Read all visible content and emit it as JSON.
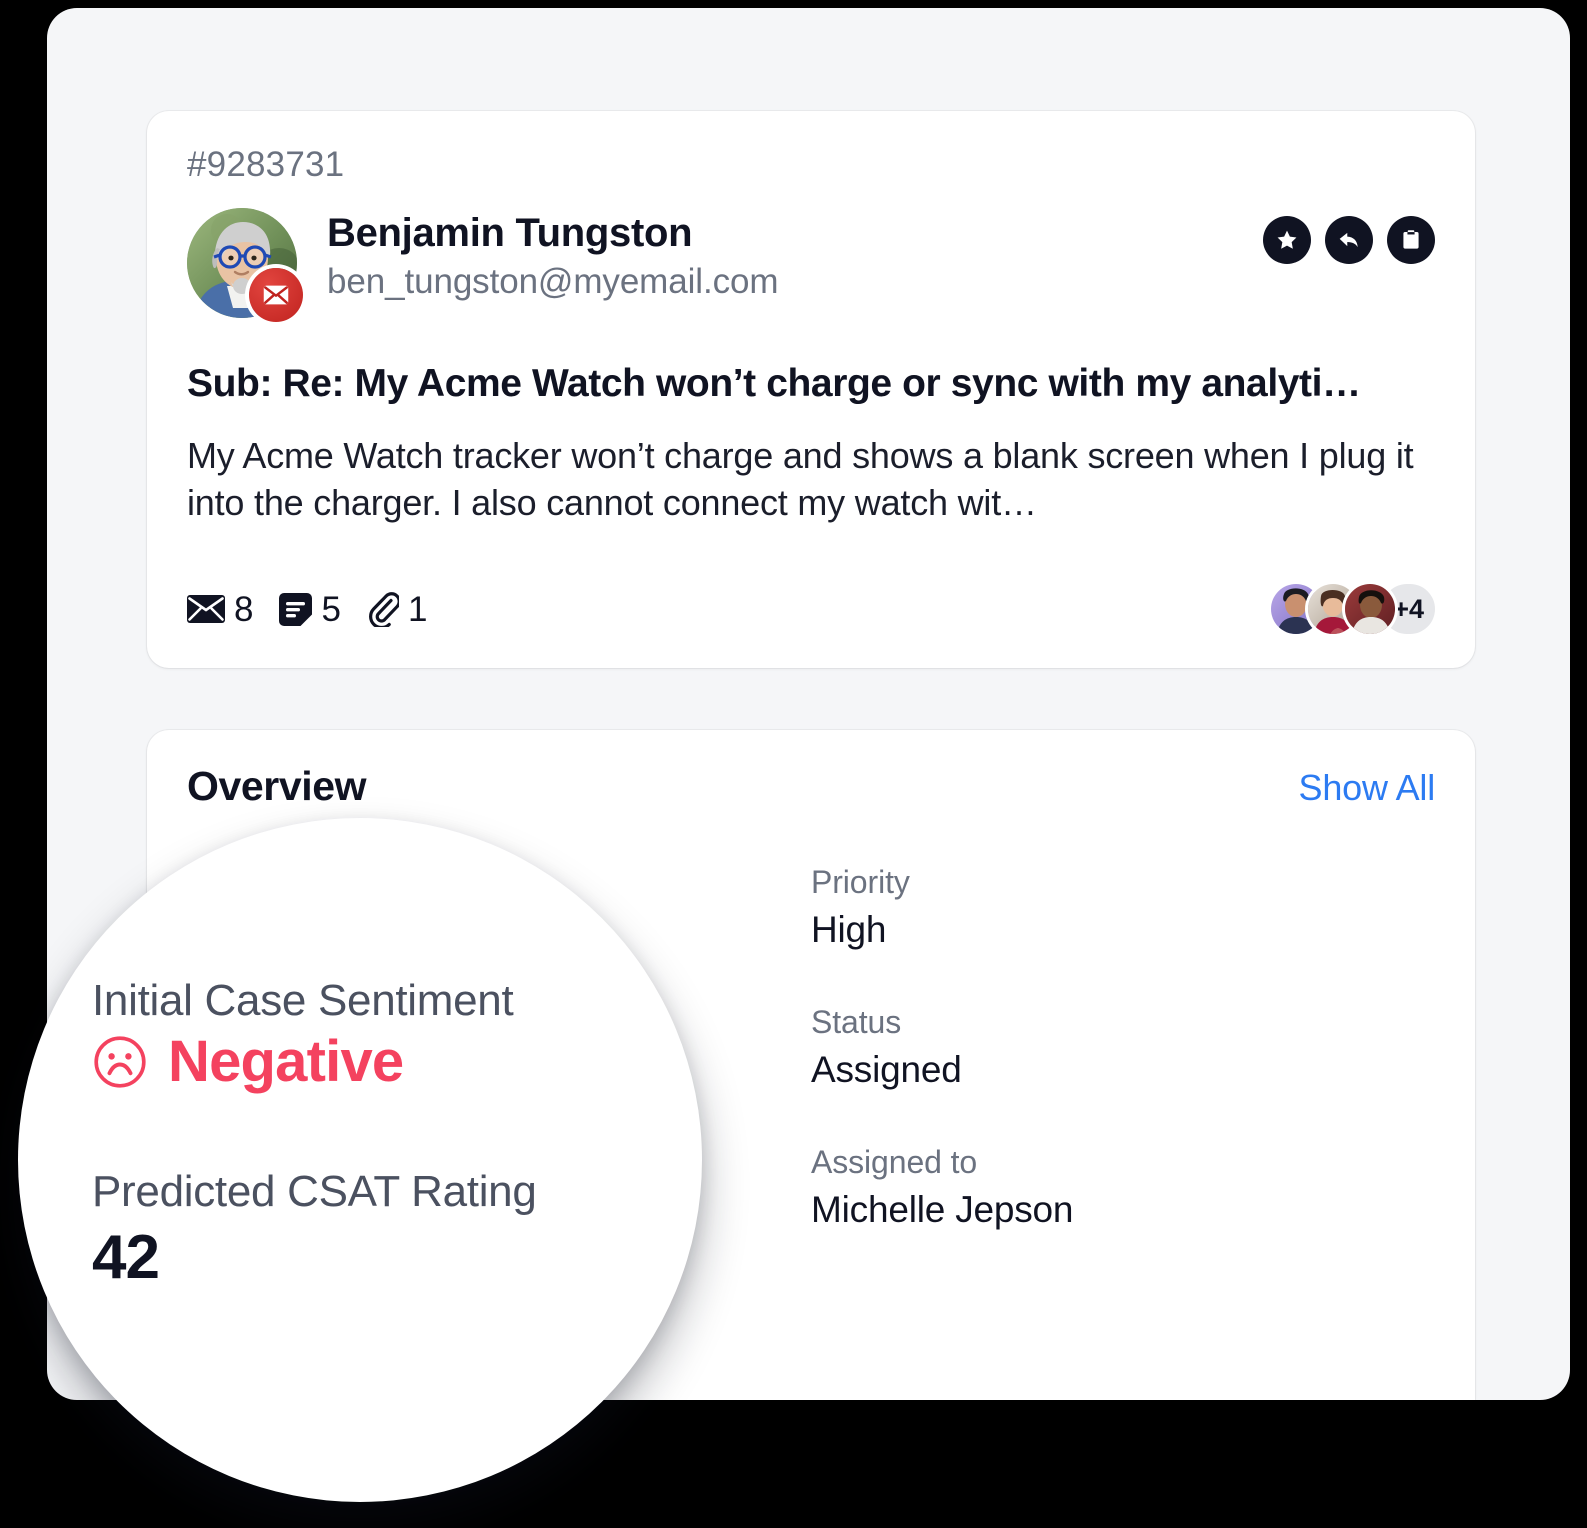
{
  "colors": {
    "accent_blue": "#2c7bf2",
    "negative_red": "#f4425f",
    "dark": "#101322",
    "muted": "#6b7280",
    "page_bg": "#f5f6f8",
    "card_bg": "#ffffff",
    "badge_red": "#c0231f"
  },
  "ticket": {
    "id": "#9283731",
    "sender_name": "Benjamin Tungston",
    "sender_email": "ben_tungston@myemail.com",
    "channel_icon": "email-icon",
    "subject": "Sub: Re: My Acme Watch won’t charge or sync with my analyti…",
    "preview": "My Acme Watch tracker won’t charge and shows a blank screen when I plug it into the charger. I also cannot connect my watch wit…",
    "actions": [
      {
        "name": "star-icon",
        "label": "Star"
      },
      {
        "name": "reply-icon",
        "label": "Reply"
      },
      {
        "name": "clipboard-icon",
        "label": "Copy to clipboard"
      }
    ],
    "counters": [
      {
        "icon": "envelope-icon",
        "label": "Emails",
        "value": "8"
      },
      {
        "icon": "note-icon",
        "label": "Notes",
        "value": "5"
      },
      {
        "icon": "paperclip-icon",
        "label": "Attachments",
        "value": "1"
      }
    ],
    "participants": {
      "avatars": [
        {
          "name": "participant-avatar-1"
        },
        {
          "name": "participant-avatar-2"
        },
        {
          "name": "participant-avatar-3"
        }
      ],
      "overflow_label": "+4"
    }
  },
  "overview": {
    "title": "Overview",
    "show_all_label": "Show All",
    "left_fields": [
      {
        "label": "Initial Case Sentiment",
        "value": "Negative",
        "icon": "sad-face-icon"
      },
      {
        "label": "Predicted CSAT Rating",
        "value": "42"
      }
    ],
    "right_fields": [
      {
        "label": "Priority",
        "value": "High"
      },
      {
        "label": "Status",
        "value": "Assigned"
      },
      {
        "label": "Assigned to",
        "value": "Michelle Jepson"
      }
    ]
  },
  "magnifier": {
    "sentiment_label": "Initial Case Sentiment",
    "sentiment_value": "Negative",
    "sentiment_icon": "sad-face-icon",
    "csat_label": "Predicted CSAT Rating",
    "csat_value": "42"
  }
}
